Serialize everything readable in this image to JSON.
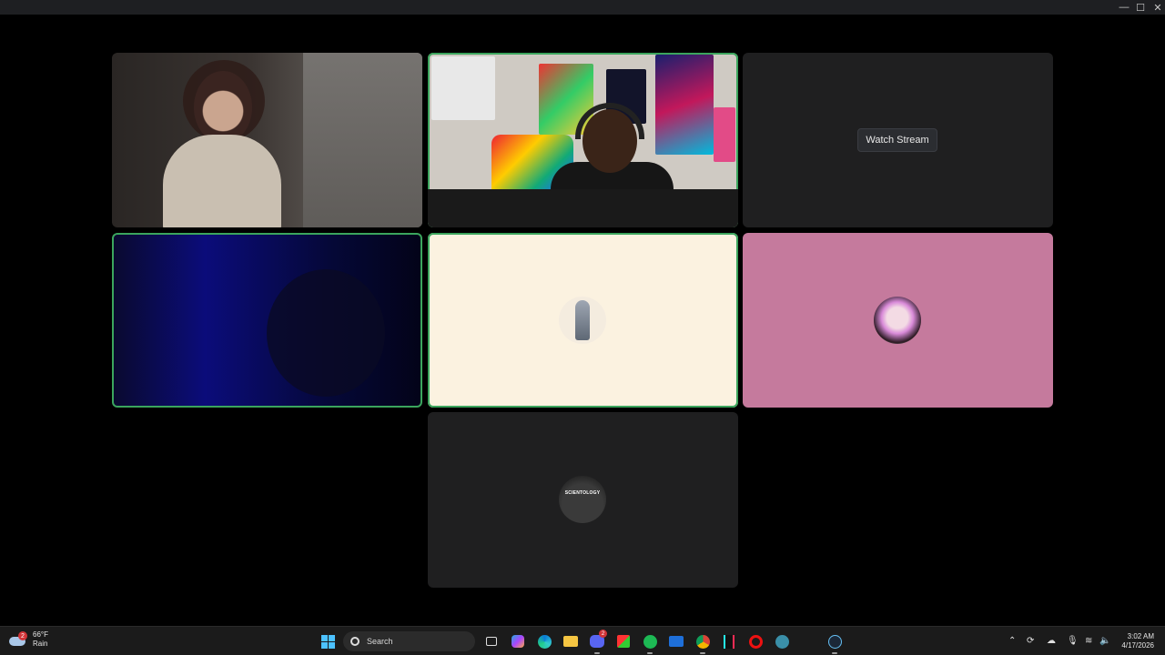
{
  "window": {
    "controls": {
      "minimize": "—",
      "maximize": "☐",
      "close": "✕"
    }
  },
  "call": {
    "tiles": [
      {
        "id": "participant-1",
        "kind": "video",
        "speaking": false
      },
      {
        "id": "participant-2",
        "kind": "video",
        "speaking": true
      },
      {
        "id": "participant-3",
        "kind": "stream",
        "watch_label": "Watch Stream"
      },
      {
        "id": "participant-4",
        "kind": "video",
        "speaking": true
      },
      {
        "id": "participant-5",
        "kind": "avatar",
        "bg": "#fbf2e0",
        "speaking": true
      },
      {
        "id": "participant-6",
        "kind": "avatar",
        "bg": "#c57a9d",
        "speaking": false
      },
      {
        "id": "participant-7",
        "kind": "avatar",
        "bg": "#1f1f20",
        "avatar_text": "SCIENTOLOGY"
      }
    ],
    "speaking_color": "#3ba55d"
  },
  "taskbar": {
    "weather": {
      "temp": "66°F",
      "condition": "Rain",
      "badge": "2"
    },
    "search_label": "Search",
    "pinned": [
      "task-view-icon",
      "copilot-icon",
      "edge-icon",
      "file-explorer-icon",
      "discord-icon",
      "store-icon",
      "spotify-icon",
      "mail-icon",
      "chrome-icon",
      "tiktok-icon",
      "opera-icon",
      "globe-app-icon",
      "steam-icon"
    ],
    "discord_badge": "2",
    "clock": {
      "time": "3:02 AM",
      "date": "4/17/2026"
    }
  }
}
